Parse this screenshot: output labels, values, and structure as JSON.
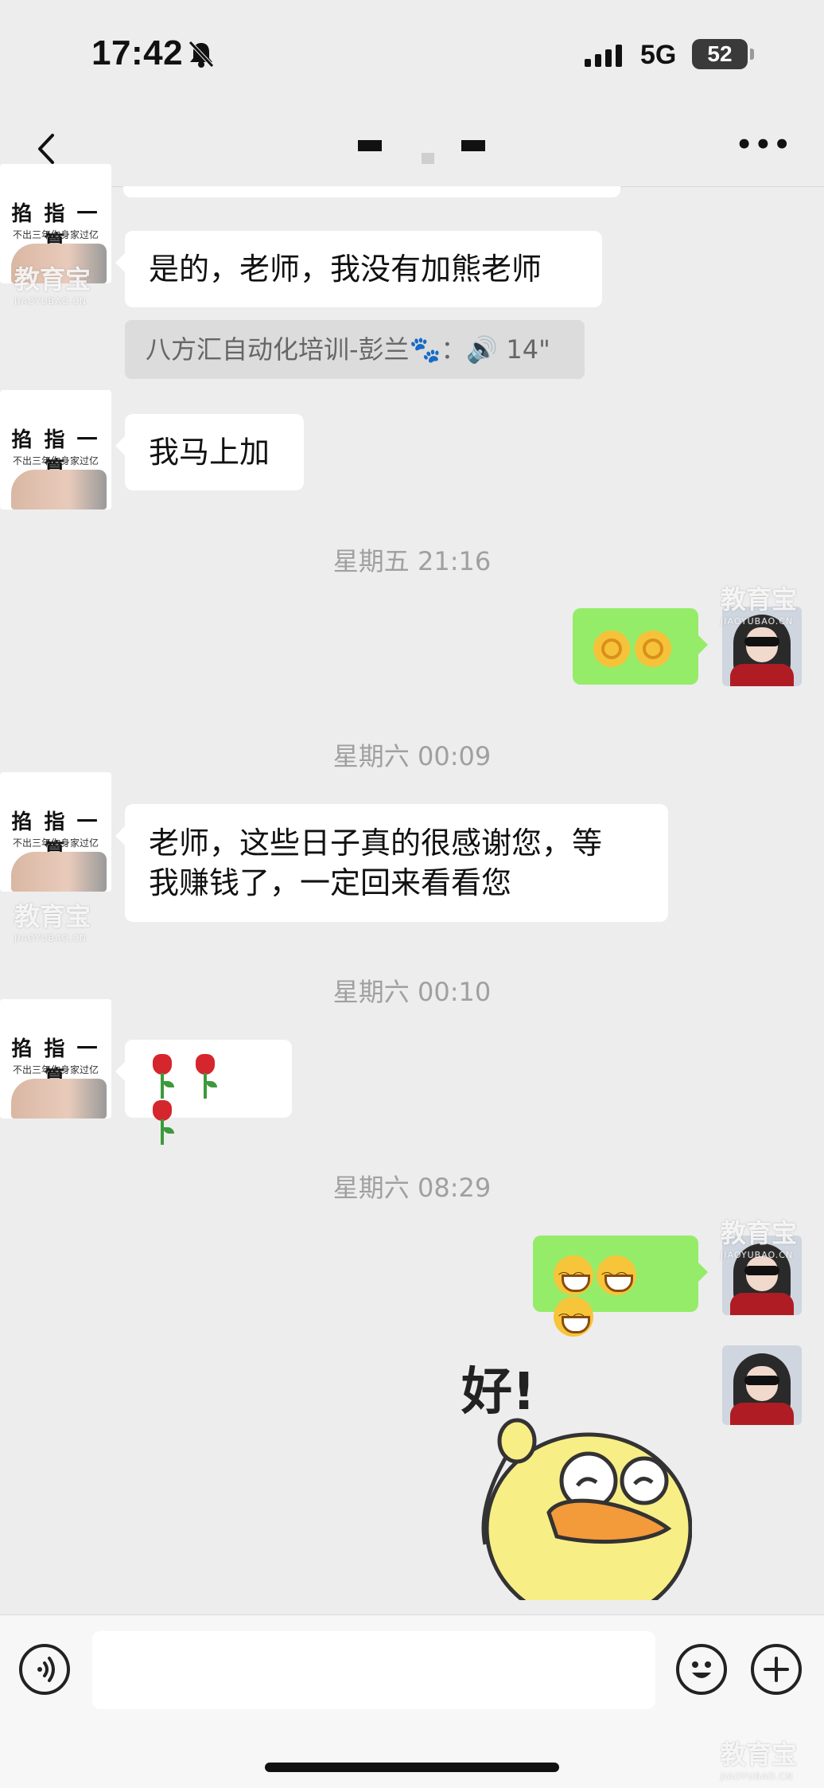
{
  "status_bar": {
    "time": "17:42",
    "network": "5G",
    "battery": "52"
  },
  "nav": {
    "title": ""
  },
  "avatar_left": {
    "big_text": "掐 指 一 算",
    "small_text": "不出三年你身家过亿"
  },
  "watermark": {
    "main": "教育宝",
    "sub": "JIAOYUBAO.CN"
  },
  "messages": {
    "m1": "是的，老师，我没有加熊老师",
    "quote": "八方汇自动化培训-彭兰🐾：🔊 14\"",
    "m2": "我马上加",
    "ts1": "星期五 21:16",
    "ts2": "星期六 00:09",
    "m3_line1": "老师，这些日子真的很感谢您，等",
    "m3_line2": "我赚钱了，一定回来看看您",
    "ts3": "星期六 00:10",
    "ts4": "星期六 08:29"
  },
  "sticker": {
    "text": "好!"
  },
  "colors": {
    "background": "#ededed",
    "sent_bubble": "#95ec69",
    "received_bubble": "#ffffff"
  }
}
